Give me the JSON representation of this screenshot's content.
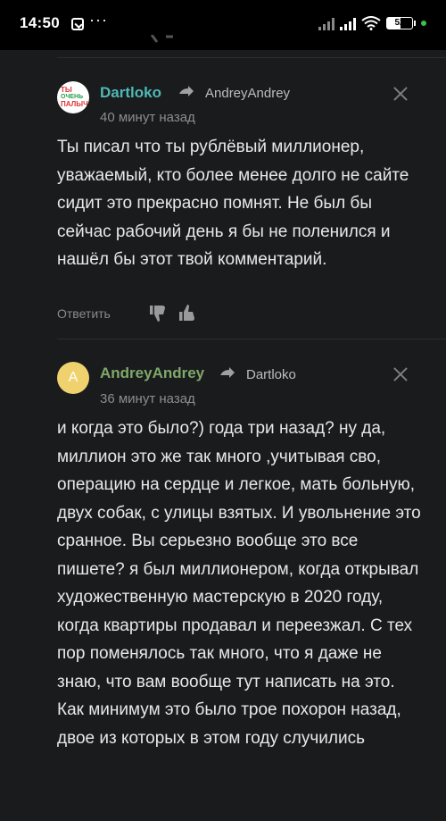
{
  "statusbar": {
    "time": "14:50",
    "battery": "52",
    "dots": "···"
  },
  "comments": [
    {
      "author": "Dartloko",
      "author_color": "#4fb8b6",
      "reply_to": "AndreyAndrey",
      "time": "40 минут назад",
      "avatar_lines": [
        "ТЫ",
        "ОЧЕНЬ",
        "ПАЛЫЧ"
      ],
      "text": "Ты писал что ты рублёвый миллионер, уважаемый, кто более менее долго не сайте сидит это прекрасно помнят. Не был бы сейчас рабочий день я бы не поленился и нашёл бы этот твой комментарий.",
      "reply_label": "Ответить"
    },
    {
      "author": "AndreyAndrey",
      "author_color": "#7fa86a",
      "reply_to": "Dartloko",
      "time": "36 минут назад",
      "avatar_letter": "A",
      "text": "и когда это было?) года три назад? ну да, миллион это же так много ,учитывая сво, операцию на сердце и легкое, мать больную, двух собак, с улицы взятых. И увольнение это сранное. Вы серьезно вообще это все пишете? я был миллионером, когда открывал художественную мастерскую в 2020 году, когда квартиры продавал и переезжал. С тех пор поменялось так много, что я даже не знаю, что вам вообще тут написать на это. Как минимум это было трое похорон назад, двое из которых в этом году случились"
    }
  ]
}
